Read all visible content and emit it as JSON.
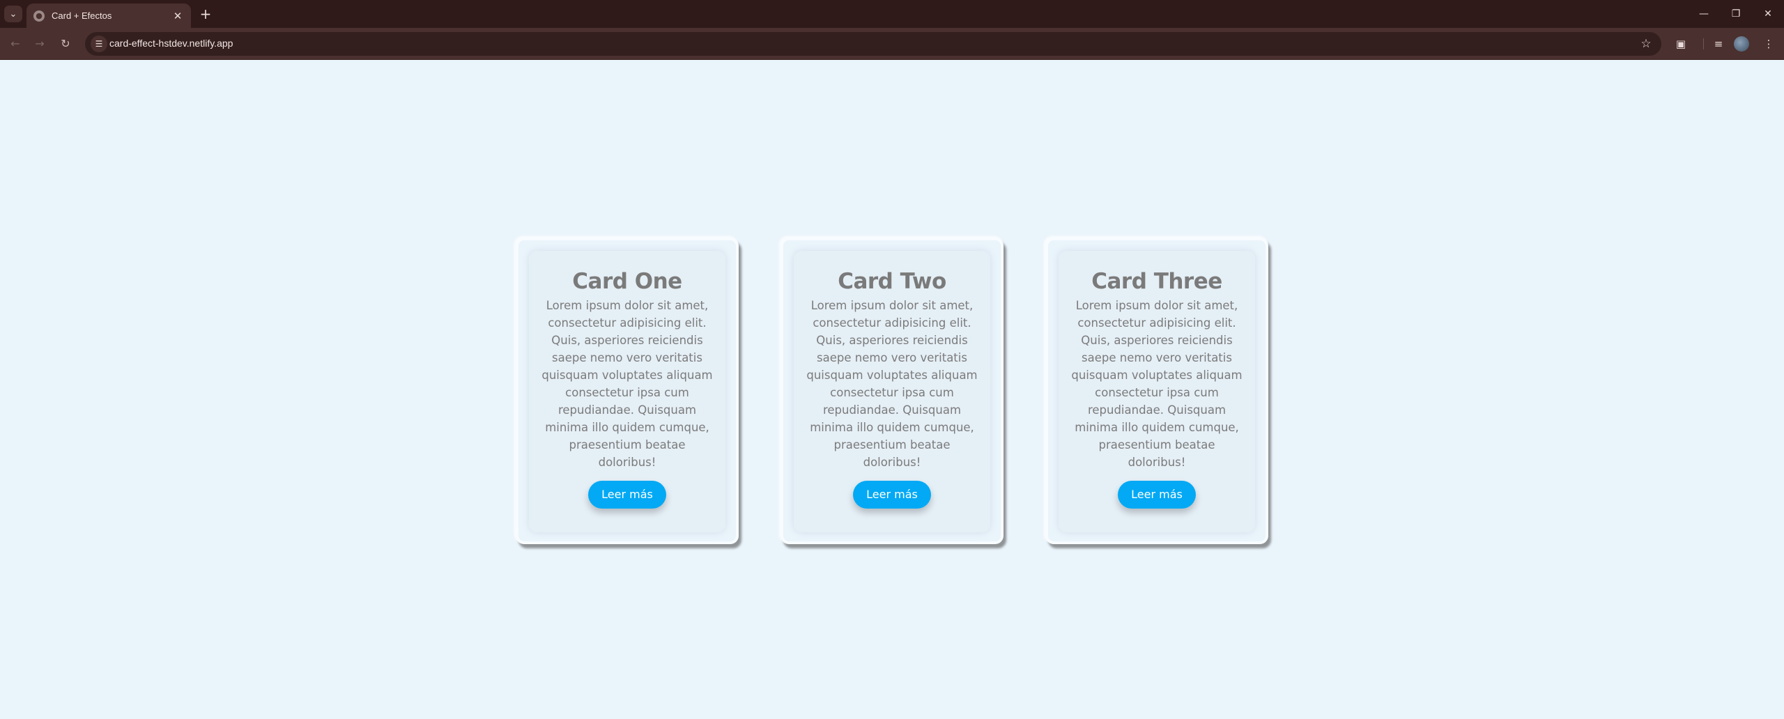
{
  "browser": {
    "tab_title": "Card + Efectos",
    "url": "card-effect-hstdev.netlify.app",
    "icons": {
      "tab_search": "chevron-down-icon",
      "favicon": "globe-icon",
      "tab_close": "close-icon",
      "new_tab": "plus-icon",
      "minimize": "minimize-icon",
      "restore": "restore-icon",
      "close_window": "close-icon",
      "back": "arrow-left-icon",
      "forward": "arrow-right-icon",
      "reload": "reload-icon",
      "site_info": "tune-icon",
      "bookmark": "star-icon",
      "extensions": "puzzle-icon",
      "media": "playlist-icon",
      "menu": "kebab-menu-icon"
    },
    "colors": {
      "tabstrip": "#2f1a19",
      "toolbar": "#4a302e",
      "omnibox": "#331f1e"
    }
  },
  "page": {
    "background": "#eaf4fb",
    "button_color": "#03a9f4",
    "cards": [
      {
        "title": "Card One",
        "text": "Lorem ipsum dolor sit amet, consectetur adipisicing elit. Quis, asperiores reiciendis saepe nemo vero veritatis quisquam voluptates aliquam consectetur ipsa cum repudiandae. Quisquam minima illo quidem cumque, praesentium beatae doloribus!",
        "button": "Leer más"
      },
      {
        "title": "Card Two",
        "text": "Lorem ipsum dolor sit amet, consectetur adipisicing elit. Quis, asperiores reiciendis saepe nemo vero veritatis quisquam voluptates aliquam consectetur ipsa cum repudiandae. Quisquam minima illo quidem cumque, praesentium beatae doloribus!",
        "button": "Leer más"
      },
      {
        "title": "Card Three",
        "text": "Lorem ipsum dolor sit amet, consectetur adipisicing elit. Quis, asperiores reiciendis saepe nemo vero veritatis quisquam voluptates aliquam consectetur ipsa cum repudiandae. Quisquam minima illo quidem cumque, praesentium beatae doloribus!",
        "button": "Leer más"
      }
    ]
  }
}
